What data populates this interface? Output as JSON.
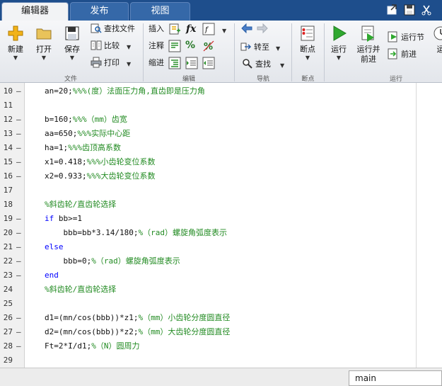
{
  "tabs": {
    "editor": "编辑器",
    "publish": "发布",
    "view": "视图"
  },
  "quick_access": [
    "undock-icon",
    "save-icon",
    "cut-icon"
  ],
  "toolstrip": {
    "file": {
      "new": "新建",
      "open": "打开",
      "save": "保存",
      "find_files": "查找文件",
      "compare": "比较",
      "print": "打印",
      "group": "文件"
    },
    "edit": {
      "insert": "插入",
      "comment": "注释",
      "indent": "缩进",
      "fx": "fx",
      "percent": "%",
      "group": "编辑"
    },
    "navigate": {
      "goto": "转至",
      "find": "查找",
      "group": "导航"
    },
    "breakpoints": {
      "breakpoints": "断点",
      "group": "断点"
    },
    "run": {
      "run": "运行",
      "run_advance": "运行并\n前进",
      "run_section": "运行节",
      "advance": "前进",
      "run_time": "运",
      "group": "运行"
    }
  },
  "editor": {
    "lines": [
      {
        "n": "10",
        "dash": true,
        "tokens": [
          {
            "t": "an=20;"
          },
          {
            "t": "%%%(度）法面压力角,直齿即是压力角",
            "c": "cm"
          }
        ]
      },
      {
        "n": "11",
        "dash": false,
        "tokens": []
      },
      {
        "n": "12",
        "dash": true,
        "tokens": [
          {
            "t": "b=160;"
          },
          {
            "t": "%%%（mm）齿宽",
            "c": "cm"
          }
        ]
      },
      {
        "n": "13",
        "dash": true,
        "tokens": [
          {
            "t": "aa=650;"
          },
          {
            "t": "%%%实际中心距",
            "c": "cm"
          }
        ]
      },
      {
        "n": "14",
        "dash": true,
        "tokens": [
          {
            "t": "ha=1;"
          },
          {
            "t": "%%%齿顶高系数",
            "c": "cm"
          }
        ]
      },
      {
        "n": "15",
        "dash": true,
        "tokens": [
          {
            "t": "x1=0.418;"
          },
          {
            "t": "%%%小齿轮变位系数",
            "c": "cm"
          }
        ]
      },
      {
        "n": "16",
        "dash": true,
        "tokens": [
          {
            "t": "x2=0.933;"
          },
          {
            "t": "%%%大齿轮变位系数",
            "c": "cm"
          }
        ]
      },
      {
        "n": "17",
        "dash": false,
        "tokens": []
      },
      {
        "n": "18",
        "dash": false,
        "tokens": [
          {
            "t": "%斜齿轮/直齿轮选择",
            "c": "cm"
          }
        ]
      },
      {
        "n": "19",
        "dash": true,
        "tokens": [
          {
            "t": "if",
            "c": "kw"
          },
          {
            "t": " bb>=1"
          }
        ]
      },
      {
        "n": "20",
        "dash": true,
        "tokens": [
          {
            "t": "    bbb=bb*3.14/180;"
          },
          {
            "t": "%（rad）螺旋角弧度表示",
            "c": "cm"
          }
        ]
      },
      {
        "n": "21",
        "dash": true,
        "tokens": [
          {
            "t": "else",
            "c": "kw"
          }
        ]
      },
      {
        "n": "22",
        "dash": true,
        "tokens": [
          {
            "t": "    bbb=0;"
          },
          {
            "t": "%（rad）螺旋角弧度表示",
            "c": "cm"
          }
        ]
      },
      {
        "n": "23",
        "dash": true,
        "tokens": [
          {
            "t": "end",
            "c": "kw"
          }
        ]
      },
      {
        "n": "24",
        "dash": false,
        "tokens": [
          {
            "t": "%斜齿轮/直齿轮选择",
            "c": "cm"
          }
        ]
      },
      {
        "n": "25",
        "dash": false,
        "tokens": []
      },
      {
        "n": "26",
        "dash": true,
        "tokens": [
          {
            "t": "d1=(mn/cos(bbb))*z1;"
          },
          {
            "t": "%（mm）小齿轮分度圆直径",
            "c": "cm"
          }
        ]
      },
      {
        "n": "27",
        "dash": true,
        "tokens": [
          {
            "t": "d2=(mn/cos(bbb))*z2;"
          },
          {
            "t": "%（mm）大齿轮分度圆直径",
            "c": "cm"
          }
        ]
      },
      {
        "n": "28",
        "dash": true,
        "tokens": [
          {
            "t": "Ft=2*I/d1;"
          },
          {
            "t": "%（N）圆周力",
            "c": "cm"
          }
        ]
      },
      {
        "n": "29",
        "dash": false,
        "tokens": []
      }
    ]
  },
  "status": {
    "function_name": "main"
  },
  "colors": {
    "keyword": "#0000ff",
    "comment": "#228b22",
    "tab_bar": "#1e4e8c"
  }
}
